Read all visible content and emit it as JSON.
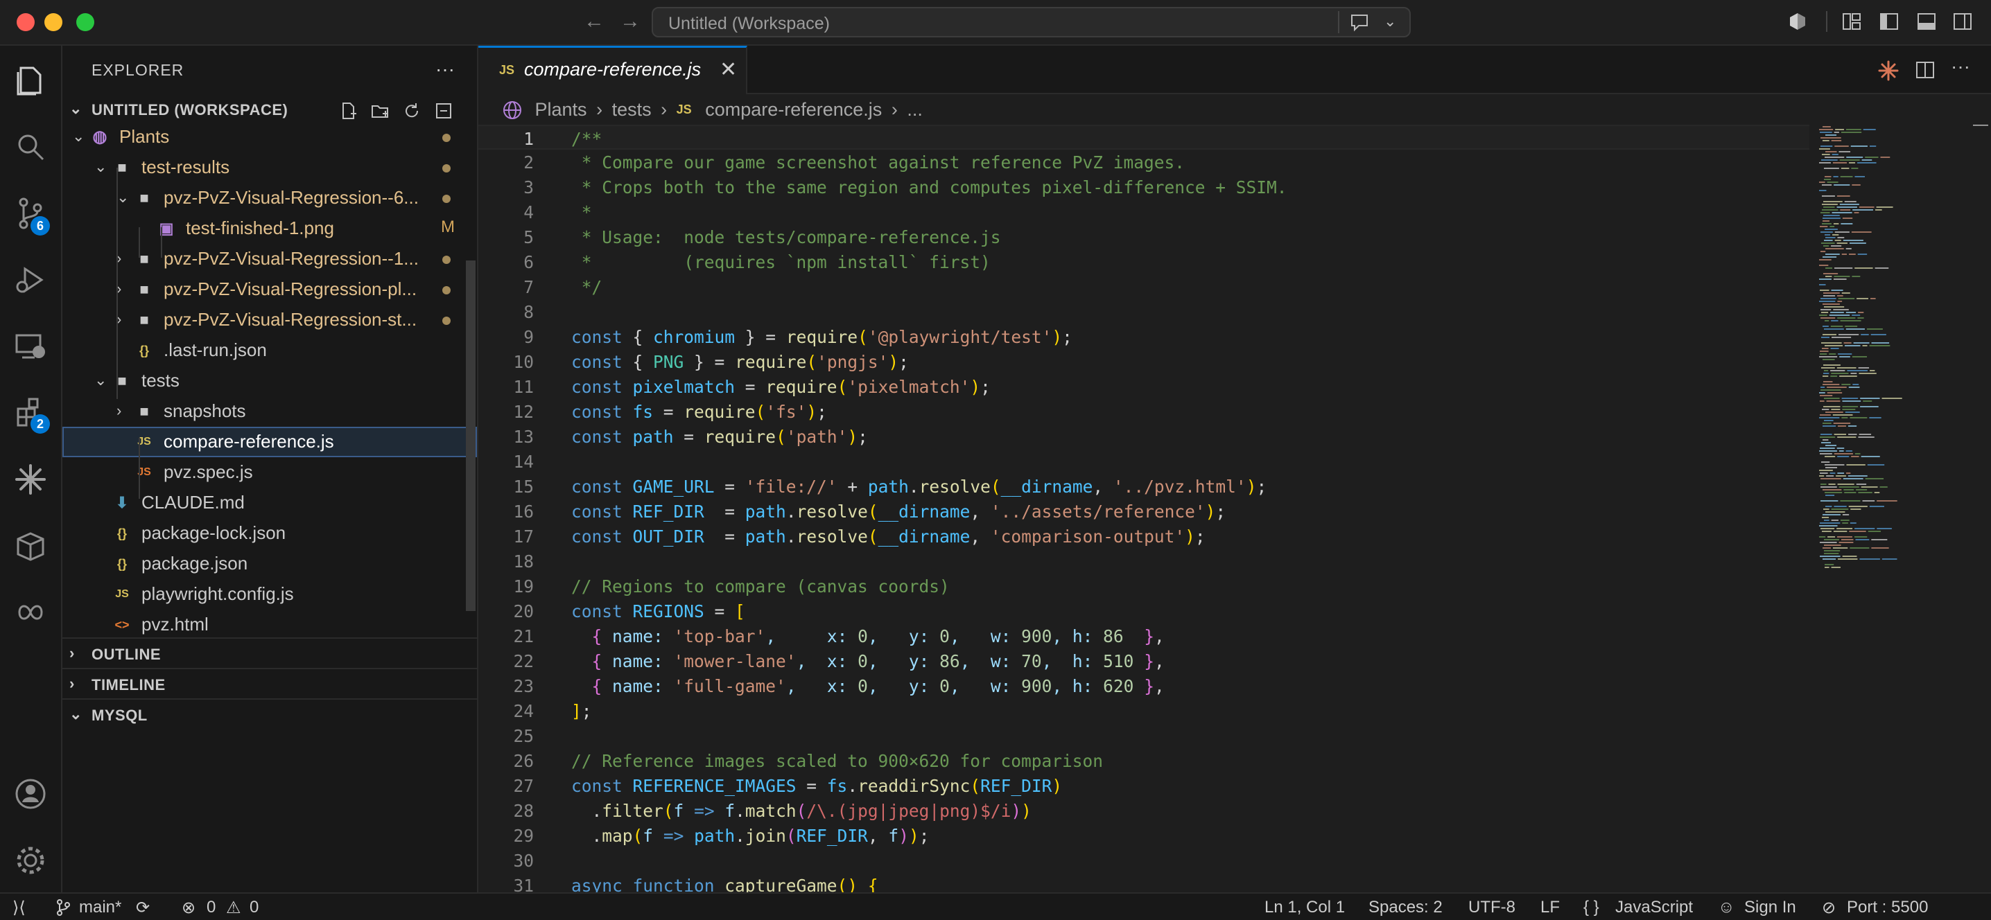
{
  "window": {
    "title": "Untitled (Workspace)"
  },
  "activity_bar": {
    "source_control_badge": "6",
    "extensions_badge": "2"
  },
  "explorer": {
    "title": "EXPLORER",
    "workspace": "UNTITLED (WORKSPACE)",
    "tree": [
      {
        "label": "Plants",
        "kind": "root",
        "indent": 0,
        "expanded": true,
        "color": "#e2c08d",
        "dot": true
      },
      {
        "label": "test-results",
        "kind": "folder",
        "indent": 1,
        "expanded": true,
        "color": "#e2c08d",
        "dot": true
      },
      {
        "label": "pvz-PvZ-Visual-Regression--6...",
        "kind": "folder",
        "indent": 2,
        "expanded": true,
        "color": "#e2c08d",
        "dot": true
      },
      {
        "label": "test-finished-1.png",
        "kind": "image",
        "indent": 3,
        "color": "#e2c08d",
        "flag": "M"
      },
      {
        "label": "pvz-PvZ-Visual-Regression--1...",
        "kind": "folder",
        "indent": 2,
        "expanded": false,
        "color": "#e2c08d",
        "dot": true
      },
      {
        "label": "pvz-PvZ-Visual-Regression-pl...",
        "kind": "folder",
        "indent": 2,
        "expanded": false,
        "color": "#e2c08d",
        "dot": true
      },
      {
        "label": "pvz-PvZ-Visual-Regression-st...",
        "kind": "folder",
        "indent": 2,
        "expanded": false,
        "color": "#e2c08d",
        "dot": true
      },
      {
        "label": ".last-run.json",
        "kind": "json",
        "indent": 2,
        "color": "#cccccc"
      },
      {
        "label": "tests",
        "kind": "folder",
        "indent": 1,
        "expanded": true,
        "color": "#cccccc"
      },
      {
        "label": "snapshots",
        "kind": "folder",
        "indent": 2,
        "expanded": false,
        "color": "#cccccc"
      },
      {
        "label": "compare-reference.js",
        "kind": "js",
        "indent": 2,
        "color": "#ffffff",
        "selected": true
      },
      {
        "label": "pvz.spec.js",
        "kind": "js-orange",
        "indent": 2,
        "color": "#cccccc"
      },
      {
        "label": "CLAUDE.md",
        "kind": "md",
        "indent": 1,
        "color": "#cccccc"
      },
      {
        "label": "package-lock.json",
        "kind": "json",
        "indent": 1,
        "color": "#cccccc"
      },
      {
        "label": "package.json",
        "kind": "json",
        "indent": 1,
        "color": "#cccccc"
      },
      {
        "label": "playwright.config.js",
        "kind": "js",
        "indent": 1,
        "color": "#cccccc"
      },
      {
        "label": "pvz.html",
        "kind": "html",
        "indent": 1,
        "color": "#cccccc"
      }
    ],
    "sections": [
      "OUTLINE",
      "TIMELINE",
      "MYSQL"
    ]
  },
  "editor": {
    "tab_label": "compare-reference.js",
    "tab_icon": "JS",
    "breadcrumbs": {
      "b1": "Plants",
      "b2": "tests",
      "b3": "compare-reference.js",
      "b4": "..."
    },
    "lines": [
      [
        [
          "/**",
          "#6a9955"
        ]
      ],
      [
        [
          " * Compare our game screenshot against reference PvZ images.",
          "#6a9955"
        ]
      ],
      [
        [
          " * Crops both to the same region and computes pixel-difference + SSIM.",
          "#6a9955"
        ]
      ],
      [
        [
          " *",
          "#6a9955"
        ]
      ],
      [
        [
          " * Usage:  node tests/compare-reference.js",
          "#6a9955"
        ]
      ],
      [
        [
          " *         (requires `npm install` first)",
          "#6a9955"
        ]
      ],
      [
        [
          " */",
          "#6a9955"
        ]
      ],
      [],
      [
        [
          "const ",
          "#569cd6"
        ],
        [
          "{ ",
          "#d4d4d4"
        ],
        [
          "chromium",
          "#4fc1ff"
        ],
        [
          " } = ",
          "#d4d4d4"
        ],
        [
          "require",
          "#dcdcaa"
        ],
        [
          "(",
          "#ffd700"
        ],
        [
          "'@playwright/test'",
          "#ce9178"
        ],
        [
          ")",
          "#ffd700"
        ],
        [
          ";",
          "#d4d4d4"
        ]
      ],
      [
        [
          "const ",
          "#569cd6"
        ],
        [
          "{ ",
          "#d4d4d4"
        ],
        [
          "PNG",
          "#4ec9b0"
        ],
        [
          " } = ",
          "#d4d4d4"
        ],
        [
          "require",
          "#dcdcaa"
        ],
        [
          "(",
          "#ffd700"
        ],
        [
          "'pngjs'",
          "#ce9178"
        ],
        [
          ")",
          "#ffd700"
        ],
        [
          ";",
          "#d4d4d4"
        ]
      ],
      [
        [
          "const ",
          "#569cd6"
        ],
        [
          "pixelmatch",
          "#4fc1ff"
        ],
        [
          " = ",
          "#d4d4d4"
        ],
        [
          "require",
          "#dcdcaa"
        ],
        [
          "(",
          "#ffd700"
        ],
        [
          "'pixelmatch'",
          "#ce9178"
        ],
        [
          ")",
          "#ffd700"
        ],
        [
          ";",
          "#d4d4d4"
        ]
      ],
      [
        [
          "const ",
          "#569cd6"
        ],
        [
          "fs",
          "#4fc1ff"
        ],
        [
          " = ",
          "#d4d4d4"
        ],
        [
          "require",
          "#dcdcaa"
        ],
        [
          "(",
          "#ffd700"
        ],
        [
          "'fs'",
          "#ce9178"
        ],
        [
          ")",
          "#ffd700"
        ],
        [
          ";",
          "#d4d4d4"
        ]
      ],
      [
        [
          "const ",
          "#569cd6"
        ],
        [
          "path",
          "#4fc1ff"
        ],
        [
          " = ",
          "#d4d4d4"
        ],
        [
          "require",
          "#dcdcaa"
        ],
        [
          "(",
          "#ffd700"
        ],
        [
          "'path'",
          "#ce9178"
        ],
        [
          ")",
          "#ffd700"
        ],
        [
          ";",
          "#d4d4d4"
        ]
      ],
      [],
      [
        [
          "const ",
          "#569cd6"
        ],
        [
          "GAME_URL",
          "#4fc1ff"
        ],
        [
          " = ",
          "#d4d4d4"
        ],
        [
          "'file://'",
          "#ce9178"
        ],
        [
          " + ",
          "#d4d4d4"
        ],
        [
          "path",
          "#4fc1ff"
        ],
        [
          ".",
          "#d4d4d4"
        ],
        [
          "resolve",
          "#dcdcaa"
        ],
        [
          "(",
          "#ffd700"
        ],
        [
          "__dirname",
          "#4fc1ff"
        ],
        [
          ", ",
          "#d4d4d4"
        ],
        [
          "'../pvz.html'",
          "#ce9178"
        ],
        [
          ")",
          "#ffd700"
        ],
        [
          ";",
          "#d4d4d4"
        ]
      ],
      [
        [
          "const ",
          "#569cd6"
        ],
        [
          "REF_DIR",
          "#4fc1ff"
        ],
        [
          "  = ",
          "#d4d4d4"
        ],
        [
          "path",
          "#4fc1ff"
        ],
        [
          ".",
          "#d4d4d4"
        ],
        [
          "resolve",
          "#dcdcaa"
        ],
        [
          "(",
          "#ffd700"
        ],
        [
          "__dirname",
          "#4fc1ff"
        ],
        [
          ", ",
          "#d4d4d4"
        ],
        [
          "'../assets/reference'",
          "#ce9178"
        ],
        [
          ")",
          "#ffd700"
        ],
        [
          ";",
          "#d4d4d4"
        ]
      ],
      [
        [
          "const ",
          "#569cd6"
        ],
        [
          "OUT_DIR",
          "#4fc1ff"
        ],
        [
          "  = ",
          "#d4d4d4"
        ],
        [
          "path",
          "#4fc1ff"
        ],
        [
          ".",
          "#d4d4d4"
        ],
        [
          "resolve",
          "#dcdcaa"
        ],
        [
          "(",
          "#ffd700"
        ],
        [
          "__dirname",
          "#4fc1ff"
        ],
        [
          ", ",
          "#d4d4d4"
        ],
        [
          "'comparison-output'",
          "#ce9178"
        ],
        [
          ")",
          "#ffd700"
        ],
        [
          ";",
          "#d4d4d4"
        ]
      ],
      [],
      [
        [
          "// Regions to compare (canvas coords)",
          "#6a9955"
        ]
      ],
      [
        [
          "const ",
          "#569cd6"
        ],
        [
          "REGIONS",
          "#4fc1ff"
        ],
        [
          " = ",
          "#d4d4d4"
        ],
        [
          "[",
          "#ffd700"
        ]
      ],
      [
        [
          "  ",
          "#d4d4d4"
        ],
        [
          "{",
          "#da70d6"
        ],
        [
          " name: ",
          "#9cdcfe"
        ],
        [
          "'top-bar'",
          "#ce9178"
        ],
        [
          ",     x: ",
          "#9cdcfe"
        ],
        [
          "0",
          "#b5cea8"
        ],
        [
          ",   y: ",
          "#9cdcfe"
        ],
        [
          "0",
          "#b5cea8"
        ],
        [
          ",   w: ",
          "#9cdcfe"
        ],
        [
          "900",
          "#b5cea8"
        ],
        [
          ", h: ",
          "#9cdcfe"
        ],
        [
          "86",
          "#b5cea8"
        ],
        [
          "  ",
          "#d4d4d4"
        ],
        [
          "}",
          "#da70d6"
        ],
        [
          ",",
          "#d4d4d4"
        ]
      ],
      [
        [
          "  ",
          "#d4d4d4"
        ],
        [
          "{",
          "#da70d6"
        ],
        [
          " name: ",
          "#9cdcfe"
        ],
        [
          "'mower-lane'",
          "#ce9178"
        ],
        [
          ",  x: ",
          "#9cdcfe"
        ],
        [
          "0",
          "#b5cea8"
        ],
        [
          ",   y: ",
          "#9cdcfe"
        ],
        [
          "86",
          "#b5cea8"
        ],
        [
          ",  w: ",
          "#9cdcfe"
        ],
        [
          "70",
          "#b5cea8"
        ],
        [
          ",  h: ",
          "#9cdcfe"
        ],
        [
          "510",
          "#b5cea8"
        ],
        [
          " ",
          "#d4d4d4"
        ],
        [
          "}",
          "#da70d6"
        ],
        [
          ",",
          "#d4d4d4"
        ]
      ],
      [
        [
          "  ",
          "#d4d4d4"
        ],
        [
          "{",
          "#da70d6"
        ],
        [
          " name: ",
          "#9cdcfe"
        ],
        [
          "'full-game'",
          "#ce9178"
        ],
        [
          ",   x: ",
          "#9cdcfe"
        ],
        [
          "0",
          "#b5cea8"
        ],
        [
          ",   y: ",
          "#9cdcfe"
        ],
        [
          "0",
          "#b5cea8"
        ],
        [
          ",   w: ",
          "#9cdcfe"
        ],
        [
          "900",
          "#b5cea8"
        ],
        [
          ", h: ",
          "#9cdcfe"
        ],
        [
          "620",
          "#b5cea8"
        ],
        [
          " ",
          "#d4d4d4"
        ],
        [
          "}",
          "#da70d6"
        ],
        [
          ",",
          "#d4d4d4"
        ]
      ],
      [
        [
          "]",
          "#ffd700"
        ],
        [
          ";",
          "#d4d4d4"
        ]
      ],
      [],
      [
        [
          "// Reference images scaled to 900×620 for comparison",
          "#6a9955"
        ]
      ],
      [
        [
          "const ",
          "#569cd6"
        ],
        [
          "REFERENCE_IMAGES",
          "#4fc1ff"
        ],
        [
          " = ",
          "#d4d4d4"
        ],
        [
          "fs",
          "#4fc1ff"
        ],
        [
          ".",
          "#d4d4d4"
        ],
        [
          "readdirSync",
          "#dcdcaa"
        ],
        [
          "(",
          "#ffd700"
        ],
        [
          "REF_DIR",
          "#4fc1ff"
        ],
        [
          ")",
          "#ffd700"
        ]
      ],
      [
        [
          "  .",
          "#d4d4d4"
        ],
        [
          "filter",
          "#dcdcaa"
        ],
        [
          "(",
          "#ffd700"
        ],
        [
          "f",
          "#9cdcfe"
        ],
        [
          " => ",
          "#569cd6"
        ],
        [
          "f",
          "#9cdcfe"
        ],
        [
          ".",
          "#d4d4d4"
        ],
        [
          "match",
          "#dcdcaa"
        ],
        [
          "(",
          "#da70d6"
        ],
        [
          "/\\.(jpg|jpeg|png)$/i",
          "#d16969"
        ],
        [
          ")",
          "#da70d6"
        ],
        [
          ")",
          "#ffd700"
        ]
      ],
      [
        [
          "  .",
          "#d4d4d4"
        ],
        [
          "map",
          "#dcdcaa"
        ],
        [
          "(",
          "#ffd700"
        ],
        [
          "f",
          "#9cdcfe"
        ],
        [
          " => ",
          "#569cd6"
        ],
        [
          "path",
          "#4fc1ff"
        ],
        [
          ".",
          "#d4d4d4"
        ],
        [
          "join",
          "#dcdcaa"
        ],
        [
          "(",
          "#da70d6"
        ],
        [
          "REF_DIR",
          "#4fc1ff"
        ],
        [
          ", ",
          "#d4d4d4"
        ],
        [
          "f",
          "#9cdcfe"
        ],
        [
          ")",
          "#da70d6"
        ],
        [
          ")",
          "#ffd700"
        ],
        [
          ";",
          "#d4d4d4"
        ]
      ],
      [],
      [
        [
          "async ",
          "#569cd6"
        ],
        [
          "function ",
          "#569cd6"
        ],
        [
          "captureGame",
          "#dcdcaa"
        ],
        [
          "() ",
          "#ffd700"
        ],
        [
          "{",
          "#ffd700"
        ]
      ]
    ]
  },
  "status_bar": {
    "branch": "main*",
    "errors": "0",
    "warnings": "0",
    "position": "Ln 1, Col 1",
    "spaces": "Spaces: 2",
    "encoding": "UTF-8",
    "eol": "LF",
    "language": "JavaScript",
    "sign_in": "Sign In",
    "port": "Port : 5500"
  }
}
